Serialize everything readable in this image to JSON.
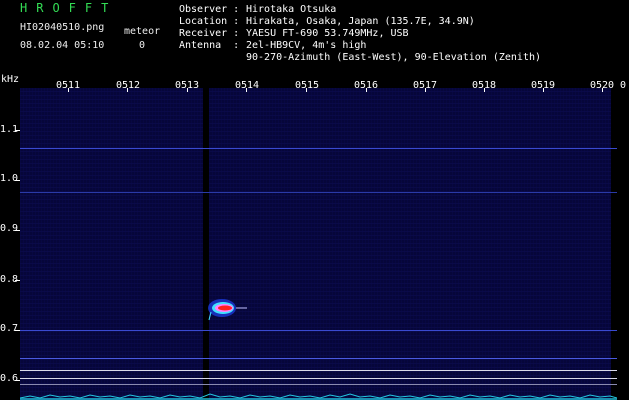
{
  "header": {
    "app_title": "HROFFT",
    "filename": "HI02040510.png",
    "meteor_label": "meteor",
    "date_time": "08.02.04 05:10",
    "meteor_count": "0"
  },
  "info": [
    {
      "key": "Observer :",
      "value": "Hirotaka Otsuka"
    },
    {
      "key": "Location :",
      "value": "Hirakata, Osaka, Japan (135.7E, 34.9N)"
    },
    {
      "key": "Receiver :",
      "value": "YAESU FT-690 53.749MHz, USB"
    },
    {
      "key": "Antenna  :",
      "value": "2el-HB9CV, 4m's high"
    },
    {
      "key": "",
      "value": "90-270-Azimuth (East-West), 90-Elevation (Zenith)"
    }
  ],
  "spectrogram": {
    "y_unit": "kHz",
    "x_ticks": [
      "0511",
      "0512",
      "0513",
      "0514",
      "0515",
      "0516",
      "0517",
      "0518",
      "0519",
      "0520",
      "0"
    ],
    "y_ticks": [
      "1.1",
      "1.0",
      "0.9",
      "0.8",
      "0.7",
      "0.6"
    ],
    "colors": {
      "background": "#06063a",
      "carrier_line": "#3a4ad0",
      "noise_floor": "#22c8e0",
      "echo_core": "#ff2020",
      "echo_mid": "#ff80ff",
      "echo_edge": "#40e0ff"
    }
  }
}
